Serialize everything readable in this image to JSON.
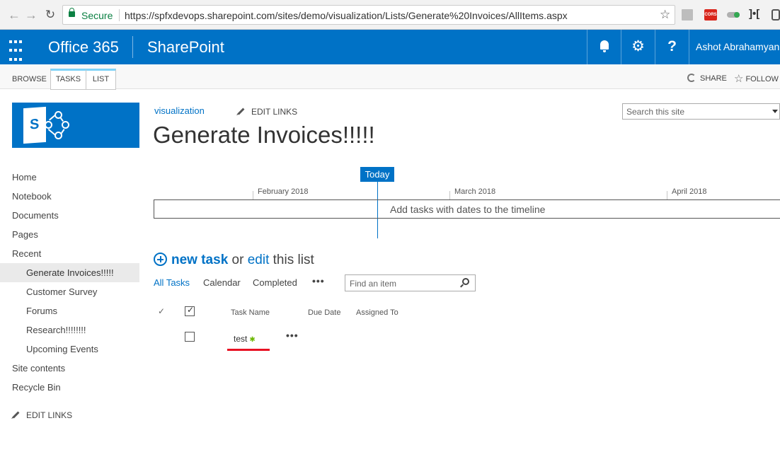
{
  "browser": {
    "secure_label": "Secure",
    "url": "https://spfxdevops.sharepoint.com/sites/demo/visualization/Lists/Generate%20Invoices/AllItems.aspx",
    "back_icon": "back-arrow-icon",
    "forward_icon": "forward-arrow-icon",
    "reload_icon": "reload-icon",
    "extensions": [
      "extension-gray-icon",
      "cors-extension-icon",
      "toggle-extension-icon",
      "bracket-extension-icon",
      "extension-frame-icon"
    ],
    "cors_label": "CORS"
  },
  "suite": {
    "brand": "Office 365",
    "app": "SharePoint",
    "user": "Ashot Abrahamyan",
    "help_glyph": "?",
    "accent": "#0072c6"
  },
  "ribbon": {
    "tabs": [
      "BROWSE",
      "TASKS",
      "LIST"
    ],
    "share": "SHARE",
    "follow": "FOLLOW"
  },
  "header": {
    "breadcrumb": "visualization",
    "edit_links": "EDIT LINKS",
    "title": "Generate Invoices!!!!!",
    "search_placeholder": "Search this site"
  },
  "leftnav": {
    "items": [
      {
        "label": "Home"
      },
      {
        "label": "Notebook"
      },
      {
        "label": "Documents"
      },
      {
        "label": "Pages"
      },
      {
        "label": "Recent"
      },
      {
        "label": "Generate Invoices!!!!!"
      },
      {
        "label": "Customer Survey"
      },
      {
        "label": "Forums"
      },
      {
        "label": "Research!!!!!!!!"
      },
      {
        "label": "Upcoming Events"
      },
      {
        "label": "Site contents"
      },
      {
        "label": "Recycle Bin"
      }
    ],
    "edit_links": "EDIT LINKS"
  },
  "timeline": {
    "today": "Today",
    "months": [
      "February 2018",
      "March 2018",
      "April 2018"
    ],
    "placeholder": "Add tasks with dates to the timeline"
  },
  "list": {
    "new_task": "new task",
    "or": "or",
    "edit": "edit",
    "this_list": "this list",
    "views": [
      "All Tasks",
      "Calendar",
      "Completed"
    ],
    "more": "•••",
    "find_placeholder": "Find an item",
    "columns": [
      "Task Name",
      "Due Date",
      "Assigned To"
    ],
    "rows": [
      {
        "task_name": "test",
        "new_badge": "✱"
      }
    ],
    "row_more": "•••"
  }
}
